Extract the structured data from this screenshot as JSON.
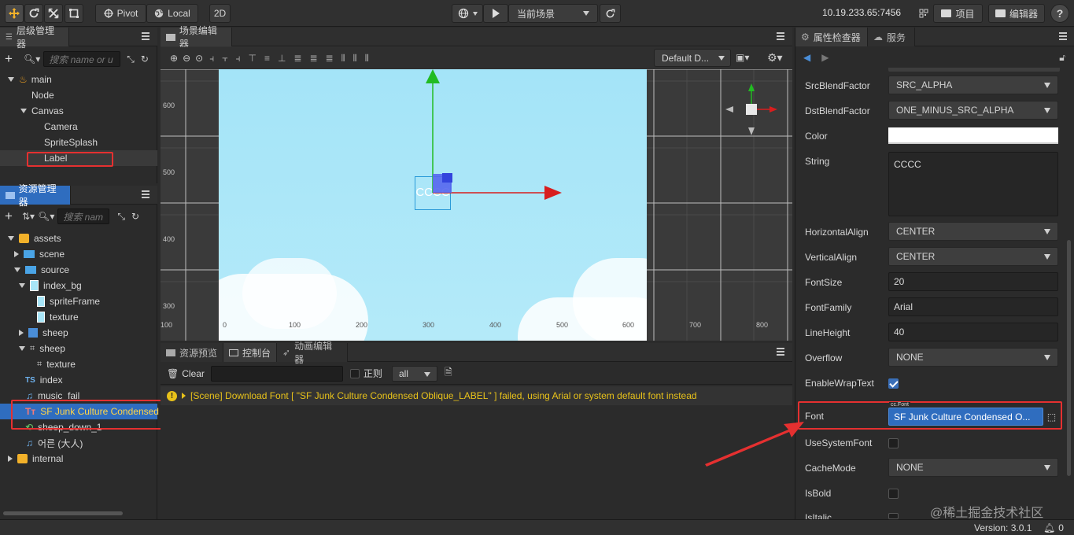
{
  "toolbar": {
    "pivot_label": "Pivot",
    "local_label": "Local",
    "mode_2d": "2D",
    "scene_select": "当前场景",
    "ip_address": "10.19.233.65:7456",
    "project_label": "项目",
    "editor_label": "编辑器"
  },
  "hierarchy": {
    "title": "层级管理器",
    "search_placeholder": "搜索 name or u",
    "items": [
      {
        "label": "main"
      },
      {
        "label": "Node"
      },
      {
        "label": "Canvas"
      },
      {
        "label": "Camera"
      },
      {
        "label": "SpriteSplash"
      },
      {
        "label": "Label"
      }
    ]
  },
  "assets": {
    "title": "资源管理器",
    "search_placeholder": "搜索 nam",
    "items": [
      {
        "label": "assets"
      },
      {
        "label": "scene"
      },
      {
        "label": "source"
      },
      {
        "label": "index_bg"
      },
      {
        "label": "spriteFrame"
      },
      {
        "label": "texture"
      },
      {
        "label": "sheep"
      },
      {
        "label": "sheep"
      },
      {
        "label": "texture"
      },
      {
        "label": "index",
        "badge": "TS"
      },
      {
        "label": "music_fail"
      },
      {
        "label": "SF Junk Culture Condensed"
      },
      {
        "label": "sheep_down_1"
      },
      {
        "label": "어른 (大人)"
      },
      {
        "label": "internal"
      }
    ]
  },
  "scene_editor": {
    "title": "场景编辑器",
    "resolution_select": "Default D...",
    "canvas_label_text": "CCCC",
    "x_ticks": [
      "100",
      "0",
      "100",
      "200",
      "300",
      "400",
      "500",
      "600",
      "700",
      "800"
    ],
    "y_ticks": [
      "600",
      "500",
      "400",
      "300"
    ]
  },
  "console": {
    "tabs": [
      "资源预览",
      "控制台",
      "动画编辑器"
    ],
    "clear_label": "Clear",
    "regex_label": "正则",
    "filter_value": "all",
    "log_message": "[Scene] Download Font [ \"SF Junk Culture Condensed Oblique_LABEL\" ] failed, using Arial or system default font instead"
  },
  "inspector": {
    "tabs": [
      "属性检查器",
      "服务"
    ],
    "props": {
      "src_blend_label": "SrcBlendFactor",
      "src_blend_value": "SRC_ALPHA",
      "dst_blend_label": "DstBlendFactor",
      "dst_blend_value": "ONE_MINUS_SRC_ALPHA",
      "color_label": "Color",
      "string_label": "String",
      "string_value": "CCCC",
      "halign_label": "HorizontalAlign",
      "halign_value": "CENTER",
      "valign_label": "VerticalAlign",
      "valign_value": "CENTER",
      "font_size_label": "FontSize",
      "font_size_value": "20",
      "font_family_label": "FontFamily",
      "font_family_value": "Arial",
      "line_height_label": "LineHeight",
      "line_height_value": "40",
      "overflow_label": "Overflow",
      "overflow_value": "NONE",
      "wrap_label": "EnableWrapText",
      "font_label": "Font",
      "font_type_tag": "cc.Font",
      "font_value": "SF Junk Culture Condensed O...",
      "system_font_label": "UseSystemFont",
      "cache_mode_label": "CacheMode",
      "cache_mode_value": "NONE",
      "bold_label": "IsBold",
      "italic_label": "IsItalic"
    }
  },
  "status_bar": {
    "version": "Version: 3.0.1",
    "notifications": "0",
    "watermark": "@稀土掘金技术社区"
  },
  "colors": {
    "accent_blue": "#2f6dbf",
    "highlight_red": "#e53030",
    "warning_yellow": "#e8c21a",
    "scene_sky": "#a8e8f8"
  }
}
